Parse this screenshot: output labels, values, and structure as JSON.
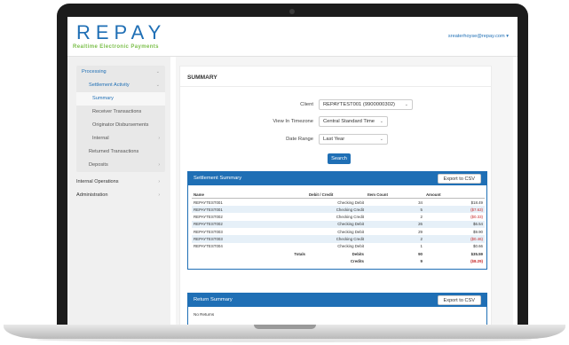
{
  "app": {
    "logo": "REPAY",
    "tagline": "Realtime Electronic Payments",
    "user_email": "sreaterhoyse@repay.com ▾"
  },
  "sidebar": {
    "items": [
      {
        "label": "Processing",
        "chevron": "⌄"
      },
      {
        "label": "Settlement Activity",
        "chevron": "⌄"
      },
      {
        "label": "Summary"
      },
      {
        "label": "Receiver Transactions"
      },
      {
        "label": "Originator Disbursements"
      },
      {
        "label": "Internal",
        "chevron": "›"
      },
      {
        "label": "Returned Transactions"
      },
      {
        "label": "Deposits",
        "chevron": "›"
      },
      {
        "label": "Internal Operations",
        "chevron": "›"
      },
      {
        "label": "Administration",
        "chevron": "›"
      }
    ]
  },
  "main": {
    "title": "SUMMARY",
    "form": {
      "client_label": "Client",
      "client_value": "REPAYTEST001 (9900000302)",
      "timezone_label": "View In Timezone",
      "timezone_value": "Central Standard Time",
      "range_label": "Date Range",
      "range_value": "Last Year",
      "search_label": "Search"
    },
    "settlement": {
      "title": "Settlement Summary",
      "export_label": "Export to CSV",
      "columns": [
        "Name",
        "Debit / Credit",
        "Item Count",
        "Amount"
      ],
      "rows": [
        {
          "name": "REPAYTEST001",
          "type": "Checking Debit",
          "count": "34",
          "amount": "$18.49"
        },
        {
          "name": "REPAYTEST001",
          "type": "Checking Credit",
          "count": "5",
          "amount": "($7.63)"
        },
        {
          "name": "REPAYTEST002",
          "type": "Checking Credit",
          "count": "2",
          "amount": "($0.33)"
        },
        {
          "name": "REPAYTEST002",
          "type": "Checking Debit",
          "count": "26",
          "amount": "$6.54"
        },
        {
          "name": "REPAYTEST003",
          "type": "Checking Debit",
          "count": "29",
          "amount": "$9.90"
        },
        {
          "name": "REPAYTEST003",
          "type": "Checking Credit",
          "count": "2",
          "amount": "($0.46)"
        },
        {
          "name": "REPAYTEST004",
          "type": "Checking Debit",
          "count": "1",
          "amount": "$0.66"
        }
      ],
      "totals": {
        "label": "Totals",
        "debits_label": "Debits",
        "credits_label": "Credits",
        "debits_count": "90",
        "credits_count": "9",
        "debits_amount": "$35.59",
        "credits_amount": "($8.29)"
      }
    },
    "returns": {
      "title": "Return Summary",
      "export_label": "Export to CSV",
      "empty_text": "No Returns"
    }
  },
  "colors": {
    "brand_blue": "#1f6fb5",
    "brand_green": "#7bbf4a",
    "negative_red": "#c62828"
  }
}
